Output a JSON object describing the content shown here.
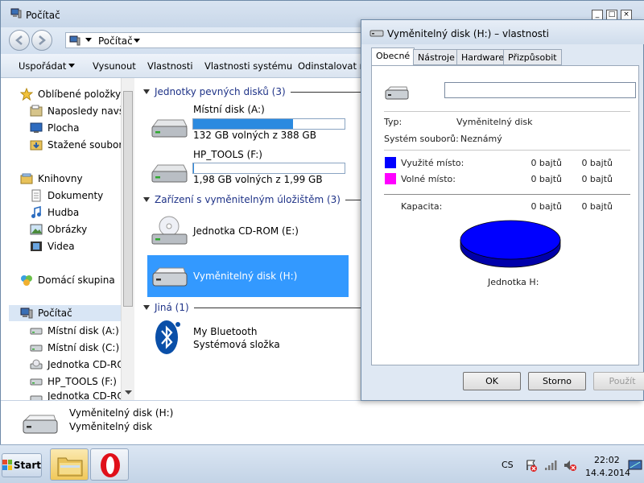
{
  "explorer": {
    "title": "Počítač",
    "breadcrumb": "Počítač",
    "commands": [
      "Uspořádat",
      "Vysunout",
      "Vlastnosti",
      "Vlastnosti systému",
      "Odinstalovat n"
    ],
    "nav": {
      "favorites": "Oblíbené položky",
      "recent": "Naposledy navští",
      "desktop": "Plocha",
      "downloads": "Stažené soubory",
      "libraries": "Knihovny",
      "documents": "Dokumenty",
      "music": "Hudba",
      "pictures": "Obrázky",
      "videos": "Videa",
      "homegroup": "Domácí skupina",
      "computer": "Počítač",
      "drive_a": "Místní disk (A:)",
      "drive_c": "Místní disk (C:)",
      "drive_e": "Jednotka CD-ROI",
      "drive_f": "HP_TOOLS (F:)",
      "drive_e2": "Jednotka CD-ROI"
    },
    "groups": {
      "hard": "Jednotky pevných disků (3)",
      "removable": "Zařízení s vyměnitelným úložištěm (3)",
      "other": "Jiná (1)"
    },
    "drives": {
      "a_name": "Místní disk (A:)",
      "a_free": "132 GB volných z 388 GB",
      "a_used_fraction": 0.66,
      "f_name": "HP_TOOLS (F:)",
      "f_free": "1,98 GB volných z 1,99 GB",
      "f_used_fraction": 0.005,
      "e_name": "Jednotka CD-ROM (E:)",
      "h_name": "Vyměnitelný disk (H:)",
      "bt_name": "My Bluetooth",
      "bt_type": "Systémová složka"
    },
    "details": {
      "name": "Vyměnitelný disk (H:)",
      "type": "Vyměnitelný disk"
    }
  },
  "dialog": {
    "title": "Vyměnitelný disk (H:) – vlastnosti",
    "tabs": [
      "Obecné",
      "Nástroje",
      "Hardware",
      "Přizpůsobit"
    ],
    "label_value": "",
    "type_label": "Typ:",
    "type_value": "Vyměnitelný disk",
    "fs_label": "Systém souborů:",
    "fs_value": "Neznámý",
    "used_label": "Využité místo:",
    "used_bytes": "0 bajtů",
    "used_human": "0 bajtů",
    "free_label": "Volné místo:",
    "free_bytes": "0 bajtů",
    "free_human": "0 bajtů",
    "capacity_label": "Kapacita:",
    "capacity_bytes": "0 bajtů",
    "capacity_human": "0 bajtů",
    "drive_caption": "Jednotka H:",
    "used_color": "#0000ff",
    "free_color": "#ff00ff",
    "ok": "OK",
    "cancel": "Storno",
    "apply": "Použít"
  },
  "taskbar": {
    "start": "Start",
    "lang": "CS",
    "time": "22:02",
    "date": "14.4.2014"
  }
}
